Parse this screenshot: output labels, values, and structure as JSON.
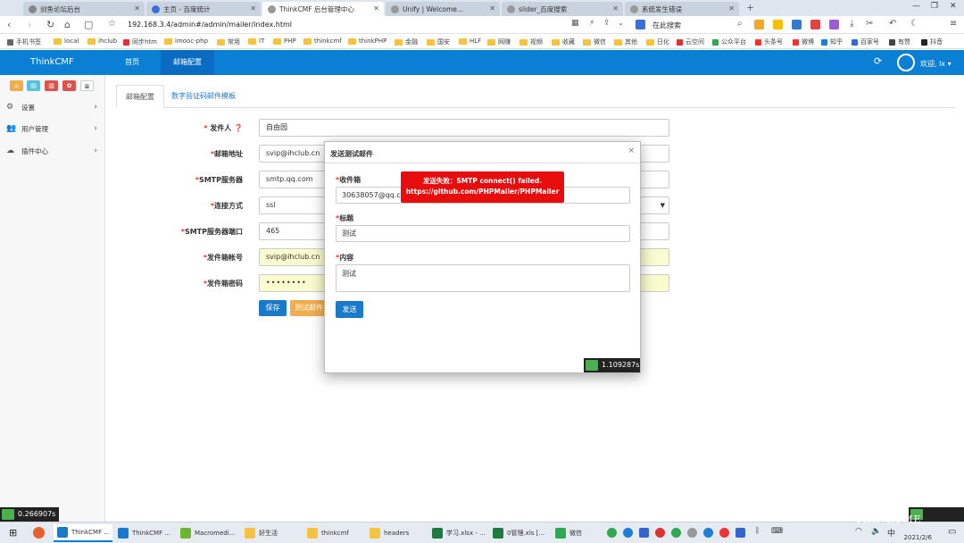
{
  "browser": {
    "tabs": [
      {
        "label": "剑鱼论坛后台",
        "color": "#888888"
      },
      {
        "label": "主页 - 百度统计",
        "color": "#3b6fd6"
      },
      {
        "label": "ThinkCMF 后台管理中心",
        "color": "#999999"
      },
      {
        "label": "Unify | Welcome...",
        "color": "#999999"
      },
      {
        "label": "slider_百度搜索",
        "color": "#999999"
      },
      {
        "label": "系统发生错误",
        "color": "#999999"
      }
    ],
    "url": "192.168.3.4/admin#/admin/mailer/index.html",
    "search_label": "在此搜索"
  },
  "bookmarks": [
    "手机书签",
    "local",
    "ihclub",
    "同步htm",
    "imooc-php",
    "常用",
    "IT",
    "PHP",
    "thinkcmf",
    "thinkPHP",
    "金融",
    "国安",
    "HLF",
    "网赚",
    "视频",
    "收藏",
    "微信",
    "其他",
    "日化",
    "云空间",
    "公众平台",
    "头条号",
    "微博",
    "知乎",
    "百家号",
    "有赞",
    "抖音"
  ],
  "app": {
    "brand": "ThinkCMF",
    "nav": [
      "首页",
      "邮箱配置"
    ],
    "welcome": "欢迎, lx ▾"
  },
  "sidebar": {
    "items": [
      {
        "label": "设置"
      },
      {
        "label": "用户管理"
      },
      {
        "label": "插件中心"
      }
    ]
  },
  "content": {
    "tabs": [
      "邮箱配置",
      "数字验证码邮件模板"
    ],
    "fields": [
      {
        "label": "发件人",
        "value": "自由园",
        "hint": true
      },
      {
        "label": "邮箱地址",
        "value": "svip@ihclub.cn"
      },
      {
        "label": "SMTP服务器",
        "value": "smtp.qq.com"
      },
      {
        "label": "连接方式",
        "value": "ssl"
      },
      {
        "label": "SMTP服务器端口",
        "value": "465"
      },
      {
        "label": "发件箱帐号",
        "value": "svip@ihclub.cn"
      },
      {
        "label": "发件箱密码",
        "value": "••••••••"
      }
    ],
    "save_label": "保存",
    "test_label": "测试邮件"
  },
  "modal": {
    "title": "发送测试邮件",
    "to_label": "收件箱",
    "to_value": "30638057@qq.co",
    "subject_label": "标题",
    "subject_value": "测试",
    "body_label": "内容",
    "body_value": "测试",
    "send_label": "发送"
  },
  "error": {
    "line1": "发送失败：SMTP connect() failed.",
    "line2": "https://github.com/PHPMailer/PHPMailer"
  },
  "timers": {
    "modal": "1.109287s",
    "page": "0.266907s"
  },
  "taskbar": {
    "apps": [
      "ThinkCMF ...",
      "ThinkCMF ...",
      "Macromedi...",
      "好生活",
      "thinkcmf",
      "headers",
      "学习.xlsx - ...",
      "0管理.xls  [...",
      "微信"
    ],
    "date": "2021/2/6"
  },
  "watermark": "THINKCME",
  "colors": {
    "header": "#0a7fd4",
    "primary_button": "#1a79c9",
    "warning_button": "#f0ad4e",
    "error": "#e80d0d"
  }
}
